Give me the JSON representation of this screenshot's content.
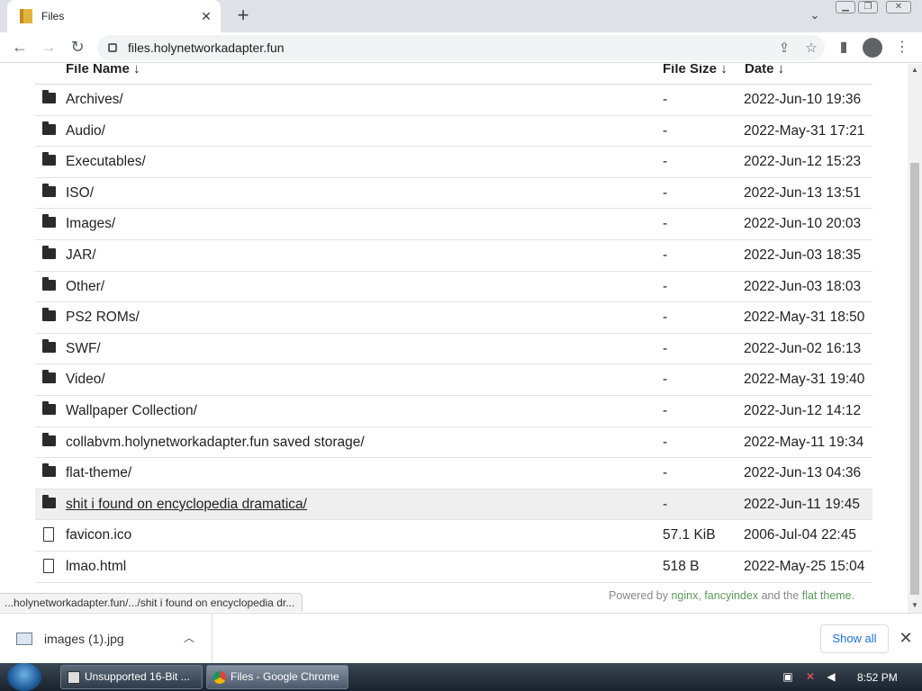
{
  "browser": {
    "tab_title": "Files",
    "url": "files.holynetworkadapter.fun"
  },
  "listing": {
    "headers": {
      "name": "File Name  ↓",
      "size": "File Size  ↓",
      "date": "Date  ↓"
    },
    "rows": [
      {
        "type": "folder",
        "name": "Archives/",
        "size": "-",
        "date": "2022-Jun-10 19:36"
      },
      {
        "type": "folder",
        "name": "Audio/",
        "size": "-",
        "date": "2022-May-31 17:21"
      },
      {
        "type": "folder",
        "name": "Executables/",
        "size": "-",
        "date": "2022-Jun-12 15:23"
      },
      {
        "type": "folder",
        "name": "ISO/",
        "size": "-",
        "date": "2022-Jun-13 13:51"
      },
      {
        "type": "folder",
        "name": "Images/",
        "size": "-",
        "date": "2022-Jun-10 20:03"
      },
      {
        "type": "folder",
        "name": "JAR/",
        "size": "-",
        "date": "2022-Jun-03 18:35"
      },
      {
        "type": "folder",
        "name": "Other/",
        "size": "-",
        "date": "2022-Jun-03 18:03"
      },
      {
        "type": "folder",
        "name": "PS2 ROMs/",
        "size": "-",
        "date": "2022-May-31 18:50"
      },
      {
        "type": "folder",
        "name": "SWF/",
        "size": "-",
        "date": "2022-Jun-02 16:13"
      },
      {
        "type": "folder",
        "name": "Video/",
        "size": "-",
        "date": "2022-May-31 19:40"
      },
      {
        "type": "folder",
        "name": "Wallpaper Collection/",
        "size": "-",
        "date": "2022-Jun-12 14:12"
      },
      {
        "type": "folder",
        "name": "collabvm.holynetworkadapter.fun saved storage/",
        "size": "-",
        "date": "2022-May-11 19:34"
      },
      {
        "type": "folder",
        "name": "flat-theme/",
        "size": "-",
        "date": "2022-Jun-13 04:36"
      },
      {
        "type": "folder",
        "name": "shit i found on encyclopedia dramatica/",
        "size": "-",
        "date": "2022-Jun-11 19:45",
        "hover": true
      },
      {
        "type": "file",
        "name": "favicon.ico",
        "size": "57.1 KiB",
        "date": "2006-Jul-04 22:45"
      },
      {
        "type": "file",
        "name": "lmao.html",
        "size": "518 B",
        "date": "2022-May-25 15:04"
      }
    ]
  },
  "footer": {
    "prefix": "Powered by ",
    "link1": "nginx",
    "sep1": ", ",
    "link2": "fancyindex",
    "mid": " and the ",
    "link3": "flat theme",
    "suffix": "."
  },
  "status_url": "...holynetworkadapter.fun/.../shit i found on encyclopedia dr...",
  "downloads": {
    "file_name": "images (1).jpg",
    "show_all": "Show all"
  },
  "taskbar": {
    "tasks": [
      "Unsupported 16-Bit ...",
      "Files - Google Chrome"
    ],
    "clock": "8:52 PM"
  }
}
